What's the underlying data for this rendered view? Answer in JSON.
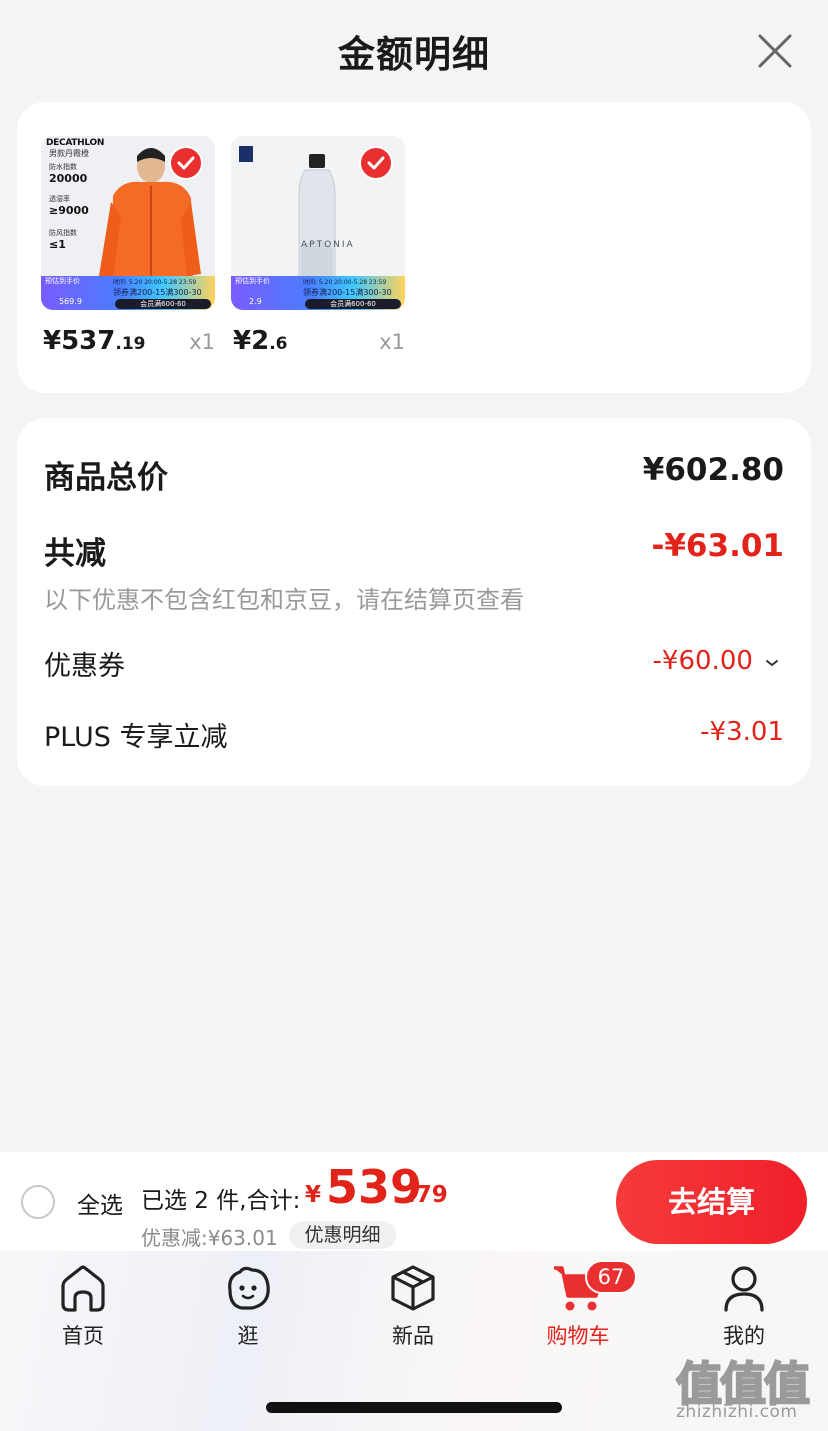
{
  "sheet": {
    "title": "金额明细",
    "close_icon": "close-icon"
  },
  "products": [
    {
      "brand": "DECATHLON",
      "subtitle": "男款丹霞橙",
      "specs": [
        {
          "name": "防水指数",
          "value": "20000"
        },
        {
          "name": "透湿率",
          "value": "≥9000"
        },
        {
          "name": "防风指数",
          "value": "≤1"
        }
      ],
      "banner_tag": "预估到手价",
      "banner_price": "569.9",
      "banner_date": "时间: 5.20 20:00-5.28 23:59",
      "banner_promo": "领券满200-15满300-30",
      "banner_pill": "会员满600-60",
      "selected": true,
      "price_main": "¥537",
      "price_cents": ".19",
      "qty": "x1"
    },
    {
      "brand": "",
      "subtitle": "APTONIA",
      "specs": [],
      "banner_tag": "预估到手价",
      "banner_price": "2.9",
      "banner_date": "时间: 5.20 20:00-5.28 23:59",
      "banner_promo": "领券满200-15满300-30",
      "banner_pill": "会员满600-60",
      "selected": true,
      "price_main": "¥2",
      "price_cents": ".6",
      "qty": "x1"
    }
  ],
  "summary": {
    "goods_total_label": "商品总价",
    "goods_total_value": "¥602.80",
    "total_reduce_label": "共减",
    "total_reduce_value": "-¥63.01",
    "hint": "以下优惠不包含红包和京豆，请在结算页查看",
    "coupon_label": "优惠券",
    "coupon_value": "-¥60.00",
    "plus_label": "PLUS 专享立减",
    "plus_value": "-¥3.01"
  },
  "cart_bar": {
    "select_all_label": "全选",
    "selected_text": "已选 2 件,合计:",
    "total_currency": "¥",
    "total_integer": "539",
    "total_decimal": ".79",
    "saving_text": "优惠减:¥63.01",
    "detail_chip": "优惠明细",
    "checkout_label": "去结算"
  },
  "tabs": [
    {
      "label": "首页",
      "icon": "home-icon",
      "active": false
    },
    {
      "label": "逛",
      "icon": "explore-icon",
      "active": false
    },
    {
      "label": "新品",
      "icon": "box-icon",
      "active": false
    },
    {
      "label": "购物车",
      "icon": "cart-icon",
      "active": true,
      "badge": "67"
    },
    {
      "label": "我的",
      "icon": "profile-icon",
      "active": false
    }
  ],
  "watermark": {
    "glyphs": "值值值",
    "url": "zhizhizhi.com"
  },
  "colors": {
    "accent_red": "#e2231a",
    "checkout_gradient_start": "#f53b3b",
    "background": "#f4f4f4"
  }
}
